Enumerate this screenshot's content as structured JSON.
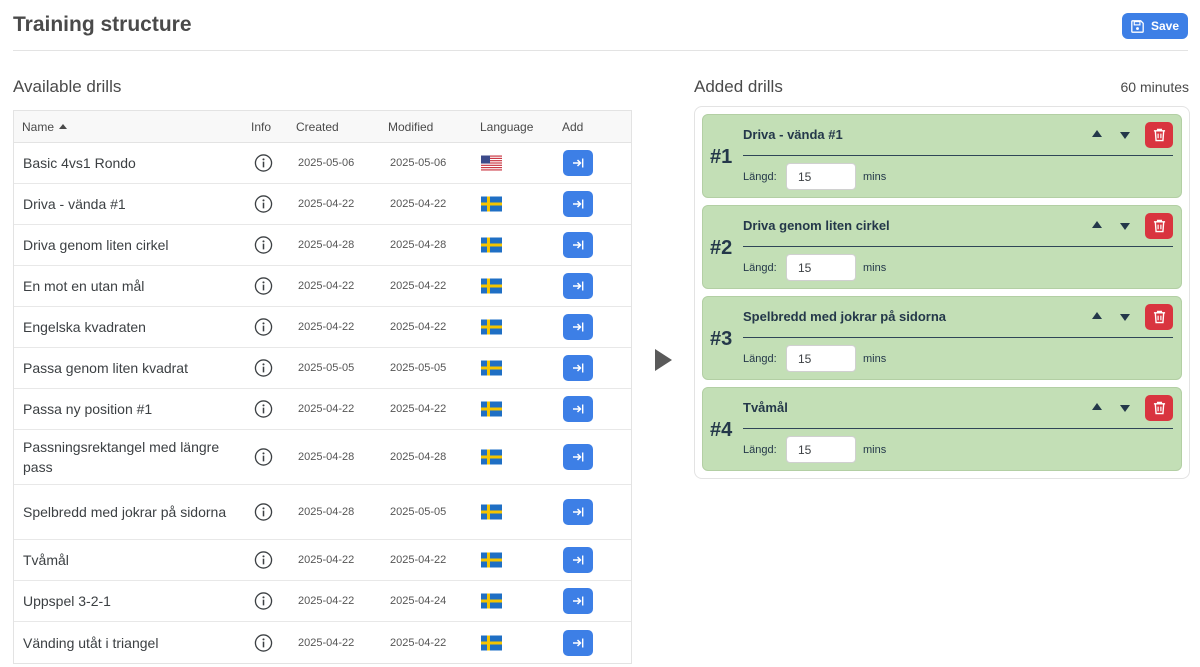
{
  "header": {
    "title": "Training structure",
    "save_label": "Save"
  },
  "available": {
    "title": "Available drills",
    "columns": {
      "name": "Name",
      "info": "Info",
      "created": "Created",
      "modified": "Modified",
      "language": "Language",
      "add": "Add"
    },
    "rows": [
      {
        "name": "Basic 4vs1 Rondo",
        "created": "2025-05-06",
        "modified": "2025-05-06",
        "language": "us-flag"
      },
      {
        "name": "Driva - vända #1",
        "created": "2025-04-22",
        "modified": "2025-04-22",
        "language": "se-flag"
      },
      {
        "name": "Driva genom liten cirkel",
        "created": "2025-04-28",
        "modified": "2025-04-28",
        "language": "se-flag"
      },
      {
        "name": "En mot en utan mål",
        "created": "2025-04-22",
        "modified": "2025-04-22",
        "language": "se-flag"
      },
      {
        "name": "Engelska kvadraten",
        "created": "2025-04-22",
        "modified": "2025-04-22",
        "language": "se-flag"
      },
      {
        "name": "Passa genom liten kvadrat",
        "created": "2025-05-05",
        "modified": "2025-05-05",
        "language": "se-flag"
      },
      {
        "name": "Passa ny position #1",
        "created": "2025-04-22",
        "modified": "2025-04-22",
        "language": "se-flag"
      },
      {
        "name": "Passningsrektangel med längre pass",
        "created": "2025-04-28",
        "modified": "2025-04-28",
        "language": "se-flag"
      },
      {
        "name": "Spelbredd med jokrar på sidorna",
        "created": "2025-04-28",
        "modified": "2025-05-05",
        "language": "se-flag"
      },
      {
        "name": "Tvåmål",
        "created": "2025-04-22",
        "modified": "2025-04-22",
        "language": "se-flag"
      },
      {
        "name": "Uppspel 3-2-1",
        "created": "2025-04-22",
        "modified": "2025-04-24",
        "language": "se-flag"
      },
      {
        "name": "Vänding utåt i triangel",
        "created": "2025-04-22",
        "modified": "2025-04-22",
        "language": "se-flag"
      }
    ]
  },
  "added": {
    "title": "Added drills",
    "total": "60 minutes",
    "length_label": "Längd:",
    "unit": "mins",
    "items": [
      {
        "num": "#1",
        "name": "Driva - vända #1",
        "length": "15"
      },
      {
        "num": "#2",
        "name": "Driva genom liten cirkel",
        "length": "15"
      },
      {
        "num": "#3",
        "name": "Spelbredd med jokrar på sidorna",
        "length": "15"
      },
      {
        "num": "#4",
        "name": "Tvåmål",
        "length": "15"
      }
    ]
  },
  "colors": {
    "primary": "#3d7fe6",
    "danger": "#d9343f",
    "card_bg": "#c3dfb6",
    "card_text": "#24384a"
  }
}
